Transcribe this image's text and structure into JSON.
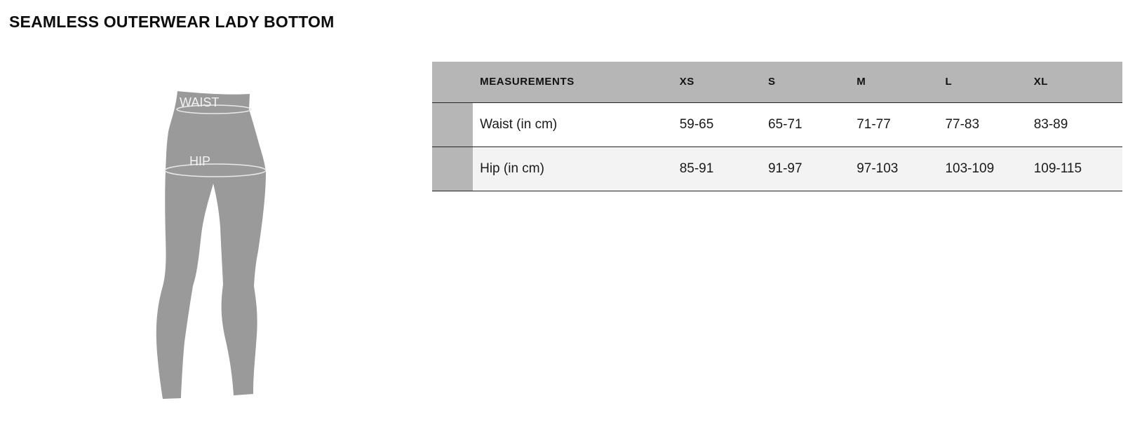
{
  "page": {
    "title": "SEAMLESS OUTERWEAR LADY BOTTOM"
  },
  "illustration": {
    "icon": "leggings-silhouette-icon",
    "waist_label": "WAIST",
    "hip_label": "HIP",
    "fill_color": "#9a9a9a",
    "line_color": "#e8e8e8"
  },
  "table": {
    "header": {
      "measurements_label": "MEASUREMENTS",
      "sizes": [
        "XS",
        "S",
        "M",
        "L",
        "XL"
      ]
    },
    "rows": [
      {
        "label": "Waist (in cm)",
        "values": [
          "59-65",
          "65-71",
          "71-77",
          "77-83",
          "83-89"
        ]
      },
      {
        "label": "Hip (in cm)",
        "values": [
          "85-91",
          "91-97",
          "97-103",
          "103-109",
          "109-115"
        ]
      }
    ],
    "colors": {
      "header_bg": "#b6b6b6",
      "swatch": "#b6b6b6",
      "row_alt_bg": "#f3f3f3",
      "border": "#222222"
    }
  }
}
